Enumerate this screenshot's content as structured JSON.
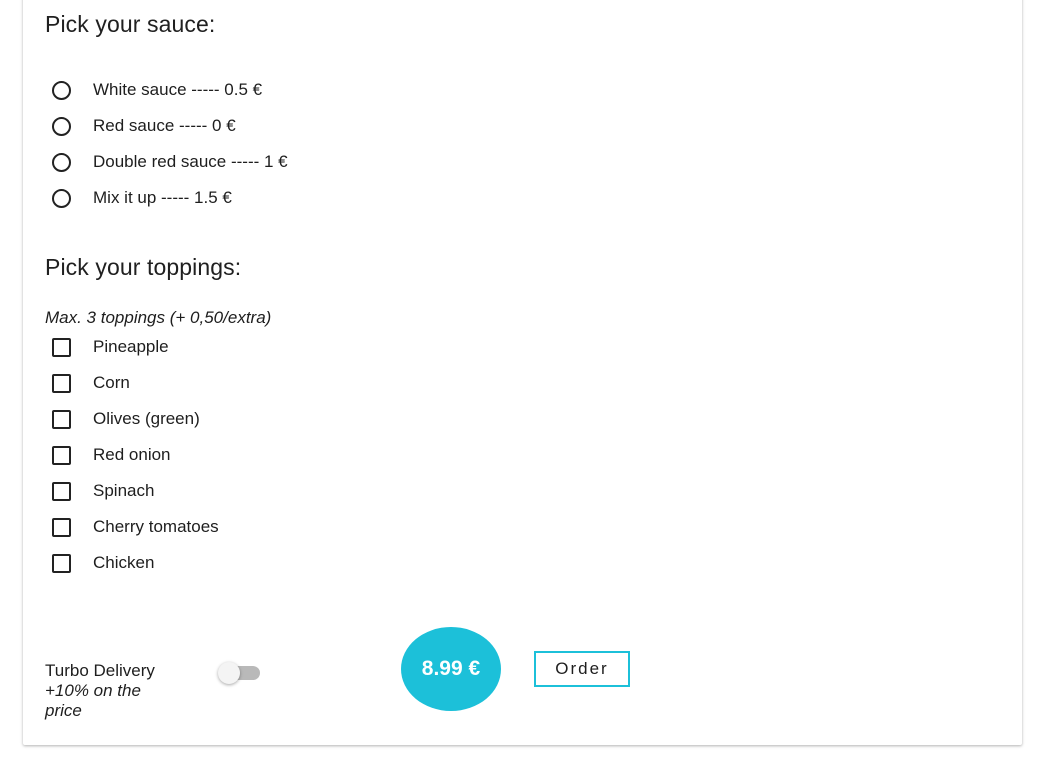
{
  "sauce": {
    "title": "Pick your sauce:",
    "options": [
      {
        "label": "White sauce ----- 0.5 €",
        "selected": false
      },
      {
        "label": "Red sauce ----- 0 €",
        "selected": false
      },
      {
        "label": "Double red sauce ----- 1 €",
        "selected": false
      },
      {
        "label": "Mix it up ----- 1.5 €",
        "selected": false
      }
    ]
  },
  "toppings": {
    "title": "Pick your toppings:",
    "note": "Max. 3 toppings (+ 0,50/extra)",
    "items": [
      {
        "label": "Pineapple",
        "checked": false
      },
      {
        "label": "Corn",
        "checked": false
      },
      {
        "label": "Olives (green)",
        "checked": false
      },
      {
        "label": "Red onion",
        "checked": false
      },
      {
        "label": "Spinach",
        "checked": false
      },
      {
        "label": "Cherry tomatoes",
        "checked": false
      },
      {
        "label": "Chicken",
        "checked": false
      }
    ]
  },
  "footer": {
    "turbo_label": "Turbo Delivery",
    "turbo_sub": "+10% on the price",
    "turbo_enabled": false,
    "price": "8.99 €",
    "order_label": "Order"
  },
  "colors": {
    "accent": "#1cc0d9",
    "toggle_track": "#b9b9b9"
  }
}
